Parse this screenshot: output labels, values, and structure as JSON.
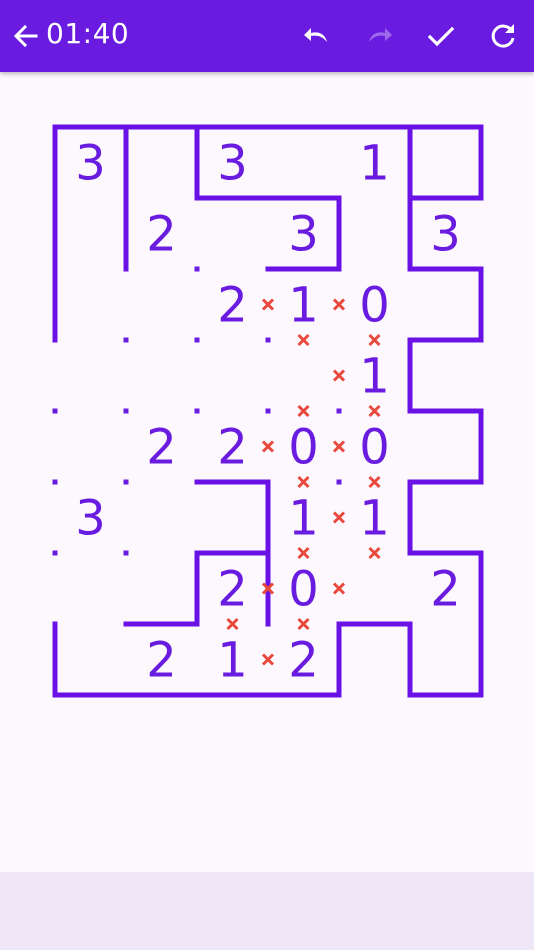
{
  "toolbar": {
    "back_icon": "arrow-left-icon",
    "timer": "01:40",
    "undo_icon": "undo-icon",
    "redo_icon": "redo-icon",
    "check_icon": "check-icon",
    "restart_icon": "refresh-icon"
  },
  "colors": {
    "accent": "#6a1be0",
    "wall": "#6a12e6",
    "clue": "#6a1be0",
    "cross": "#e8493b",
    "dot": "#6a1be0",
    "background": "#fcf8fe",
    "bottom_bar": "#efe6f8"
  },
  "puzzle": {
    "cols": 6,
    "rows": 8,
    "clues": [
      {
        "r": 0,
        "c": 0,
        "v": "3"
      },
      {
        "r": 0,
        "c": 2,
        "v": "3"
      },
      {
        "r": 0,
        "c": 4,
        "v": "1"
      },
      {
        "r": 1,
        "c": 1,
        "v": "2"
      },
      {
        "r": 1,
        "c": 3,
        "v": "3"
      },
      {
        "r": 1,
        "c": 5,
        "v": "3"
      },
      {
        "r": 2,
        "c": 2,
        "v": "2"
      },
      {
        "r": 2,
        "c": 3,
        "v": "1"
      },
      {
        "r": 2,
        "c": 4,
        "v": "0"
      },
      {
        "r": 3,
        "c": 4,
        "v": "1"
      },
      {
        "r": 4,
        "c": 1,
        "v": "2"
      },
      {
        "r": 4,
        "c": 2,
        "v": "2"
      },
      {
        "r": 4,
        "c": 3,
        "v": "0"
      },
      {
        "r": 4,
        "c": 4,
        "v": "0"
      },
      {
        "r": 5,
        "c": 0,
        "v": "3"
      },
      {
        "r": 5,
        "c": 3,
        "v": "1"
      },
      {
        "r": 5,
        "c": 4,
        "v": "1"
      },
      {
        "r": 6,
        "c": 2,
        "v": "2"
      },
      {
        "r": 6,
        "c": 3,
        "v": "0"
      },
      {
        "r": 6,
        "c": 5,
        "v": "2"
      },
      {
        "r": 7,
        "c": 1,
        "v": "2"
      },
      {
        "r": 7,
        "c": 2,
        "v": "1"
      },
      {
        "r": 7,
        "c": 3,
        "v": "2"
      }
    ],
    "h_walls": [
      [
        0,
        0
      ],
      [
        1,
        0
      ],
      [
        2,
        0
      ],
      [
        3,
        0
      ],
      [
        4,
        0
      ],
      [
        5,
        0
      ],
      [
        2,
        1
      ],
      [
        3,
        1
      ],
      [
        5,
        1
      ],
      [
        3,
        2
      ],
      [
        5,
        2
      ],
      [
        5,
        3
      ],
      [
        5,
        4
      ],
      [
        2,
        5
      ],
      [
        5,
        5
      ],
      [
        2,
        6
      ],
      [
        5,
        6
      ],
      [
        1,
        7
      ],
      [
        4,
        7
      ],
      [
        0,
        8
      ],
      [
        1,
        8
      ],
      [
        2,
        8
      ],
      [
        3,
        8
      ],
      [
        5,
        8
      ]
    ],
    "v_walls": [
      [
        0,
        0
      ],
      [
        1,
        0
      ],
      [
        2,
        0
      ],
      [
        5,
        0
      ],
      [
        6,
        0
      ],
      [
        0,
        1
      ],
      [
        1,
        1
      ],
      [
        4,
        1
      ],
      [
        5,
        1
      ],
      [
        0,
        2
      ],
      [
        6,
        2
      ],
      [
        5,
        3
      ],
      [
        6,
        4
      ],
      [
        3,
        5
      ],
      [
        5,
        5
      ],
      [
        2,
        6
      ],
      [
        3,
        6
      ],
      [
        6,
        6
      ],
      [
        0,
        7
      ],
      [
        4,
        7
      ],
      [
        5,
        7
      ],
      [
        6,
        7
      ]
    ],
    "h_crosses": [
      [
        3,
        3
      ],
      [
        4,
        3
      ],
      [
        3,
        4
      ],
      [
        4,
        4
      ],
      [
        3,
        5
      ],
      [
        4,
        5
      ],
      [
        3,
        6
      ],
      [
        4,
        6
      ],
      [
        2,
        7
      ],
      [
        3,
        7
      ]
    ],
    "v_crosses": [
      [
        3,
        2
      ],
      [
        4,
        2
      ],
      [
        4,
        3
      ],
      [
        3,
        4
      ],
      [
        4,
        4
      ],
      [
        4,
        5
      ],
      [
        3,
        6
      ],
      [
        4,
        6
      ],
      [
        3,
        7
      ]
    ],
    "dots": [
      [
        2,
        2
      ],
      [
        1,
        3
      ],
      [
        2,
        3
      ],
      [
        3,
        3
      ],
      [
        0,
        4
      ],
      [
        1,
        4
      ],
      [
        2,
        4
      ],
      [
        3,
        4
      ],
      [
        4,
        4
      ],
      [
        0,
        5
      ],
      [
        1,
        5
      ],
      [
        0,
        6
      ],
      [
        1,
        6
      ],
      [
        3,
        7
      ],
      [
        4,
        5
      ]
    ]
  }
}
